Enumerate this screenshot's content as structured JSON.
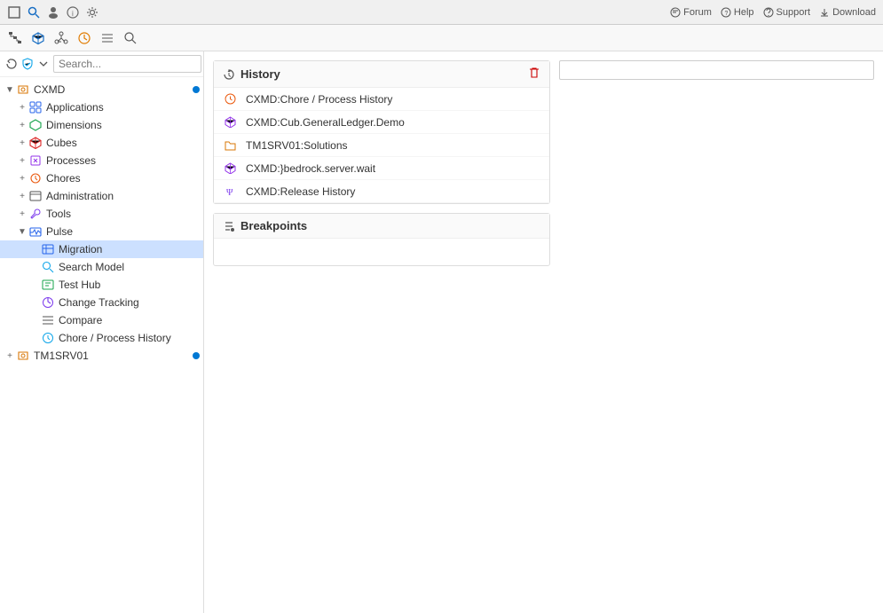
{
  "topbar": {
    "right_links": [
      {
        "id": "forum",
        "label": "Forum",
        "icon": "forum-icon"
      },
      {
        "id": "help",
        "label": "Help",
        "icon": "help-icon"
      },
      {
        "id": "support",
        "label": "Support",
        "icon": "support-icon"
      },
      {
        "id": "download",
        "label": "Download",
        "icon": "download-icon"
      }
    ]
  },
  "sidebar": {
    "search_placeholder": "Search...",
    "tree": [
      {
        "id": "cxmd",
        "label": "CXMD",
        "level": 0,
        "expanded": true,
        "icon": "server-icon",
        "color": "ic-cxmd",
        "dot": true
      },
      {
        "id": "applications",
        "label": "Applications",
        "level": 1,
        "icon": "apps-icon",
        "color": "ic-apps"
      },
      {
        "id": "dimensions",
        "label": "Dimensions",
        "level": 1,
        "icon": "dims-icon",
        "color": "ic-dims"
      },
      {
        "id": "cubes",
        "label": "Cubes",
        "level": 1,
        "icon": "cubes-icon",
        "color": "ic-cubes"
      },
      {
        "id": "processes",
        "label": "Processes",
        "level": 1,
        "icon": "procs-icon",
        "color": "ic-procs"
      },
      {
        "id": "chores",
        "label": "Chores",
        "level": 1,
        "icon": "chores-icon",
        "color": "ic-chores"
      },
      {
        "id": "administration",
        "label": "Administration",
        "level": 1,
        "icon": "admin-icon",
        "color": "ic-admin"
      },
      {
        "id": "tools",
        "label": "Tools",
        "level": 1,
        "icon": "tools-icon",
        "color": "ic-tools"
      },
      {
        "id": "pulse",
        "label": "Pulse",
        "level": 1,
        "expanded": true,
        "icon": "pulse-icon",
        "color": "ic-pulse"
      },
      {
        "id": "migration",
        "label": "Migration",
        "level": 2,
        "icon": "migration-icon",
        "color": "ic-migration",
        "selected": true
      },
      {
        "id": "searchmodel",
        "label": "Search Model",
        "level": 2,
        "icon": "searchmodel-icon",
        "color": "ic-searchmodel"
      },
      {
        "id": "testhub",
        "label": "Test Hub",
        "level": 2,
        "icon": "testhub-icon",
        "color": "ic-testhub"
      },
      {
        "id": "changetracking",
        "label": "Change Tracking",
        "level": 2,
        "icon": "changetrack-icon",
        "color": "ic-changetrack"
      },
      {
        "id": "compare",
        "label": "Compare",
        "level": 2,
        "icon": "compare-icon",
        "color": "ic-compare"
      },
      {
        "id": "chorehistory",
        "label": "Chore / Process History",
        "level": 2,
        "icon": "chore-hist-icon",
        "color": "ic-chore-hist"
      },
      {
        "id": "tm1srv01",
        "label": "TM1SRV01",
        "level": 0,
        "icon": "server-icon",
        "color": "ic-tm1srv",
        "dot": true
      }
    ]
  },
  "history_panel": {
    "title": "History",
    "clear_icon": "trash-icon",
    "items": [
      {
        "id": "h1",
        "label": "CXMD:Chore / Process History",
        "icon": "clock-icon",
        "color": "ic-hist-chore"
      },
      {
        "id": "h2",
        "label": "CXMD:Cub.GeneralLedger.Demo",
        "icon": "cube-icon",
        "color": "ic-hist-cube"
      },
      {
        "id": "h3",
        "label": "TM1SRV01:Solutions",
        "icon": "folder-icon",
        "color": "ic-hist-folder"
      },
      {
        "id": "h4",
        "label": "CXMD:}bedrock.server.wait",
        "icon": "cube-icon",
        "color": "ic-hist-wait"
      },
      {
        "id": "h5",
        "label": "CXMD:Release History",
        "icon": "psi-icon",
        "color": "ic-hist-release"
      }
    ]
  },
  "breakpoints_panel": {
    "title": "Breakpoints"
  },
  "right_panel": {
    "input_placeholder": ""
  }
}
